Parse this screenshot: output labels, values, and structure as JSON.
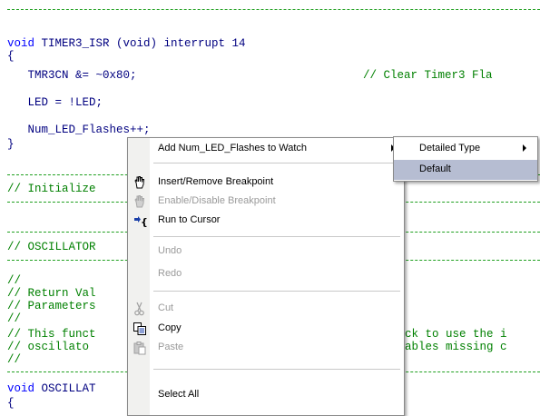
{
  "editor": {
    "lines": {
      "sep1": "//---------------------------------------------------------------------------------",
      "func_sig_kw": "void",
      "func_sig_rest": " TIMER3_ISR (void) interrupt 14",
      "open_brace": "{",
      "tmr_stmt": "   TMR3CN &= ~0x80;",
      "tmr_comment": "// Clear Timer3 Fla",
      "led_stmt": "   LED = !LED;",
      "num_stmt": "   Num_LED_Flashes++;",
      "close_brace": "}",
      "sep2": "//---------------------------------------------------------------------------------",
      "init_comment": "// Initialize",
      "sep3": "//---------------------------------------------------------------------------------",
      "sep4": "//---------------------------------------------------------------------------------",
      "osc_comment": "// OSCILLATOR",
      "sep5": "//---------------------------------------------------------------------------------",
      "blank_comment1": "//",
      "return_comment": "// Return Val",
      "params_comment": "// Parameters",
      "blank_comment2": "//",
      "this_func_comment": "// This funct",
      "this_func_tail": "ck to use the i",
      "osc_comment2": "// oscillato",
      "osc_comment2_tail": "ables missing c",
      "blank_comment3": "//",
      "sep6": "//---------------------------------------------------------------------------------",
      "void_osc_kw": "void",
      "void_osc_rest": " OSCILLAT",
      "open_brace2": "{"
    }
  },
  "context_menu": {
    "items": [
      {
        "label": "Add Num_LED_Flashes to Watch",
        "has_submenu": true,
        "enabled": true
      },
      {
        "label": "Insert/Remove Breakpoint",
        "enabled": true,
        "icon": "hand-breakpoint-icon"
      },
      {
        "label": "Enable/Disable Breakpoint",
        "enabled": false,
        "icon": "toggle-breakpoint-icon"
      },
      {
        "label": "Run to Cursor",
        "enabled": true,
        "icon": "run-to-cursor-icon"
      },
      {
        "label": "Undo",
        "enabled": false
      },
      {
        "label": "Redo",
        "enabled": false
      },
      {
        "label": "Cut",
        "enabled": false,
        "icon": "scissors-icon"
      },
      {
        "label": "Copy",
        "enabled": true,
        "icon": "copy-icon"
      },
      {
        "label": "Paste",
        "enabled": false,
        "icon": "paste-icon"
      },
      {
        "label": "Select All",
        "enabled": true
      }
    ]
  },
  "submenu": {
    "items": [
      {
        "label": "Detailed Type",
        "has_submenu": true
      },
      {
        "label": "Default",
        "highlighted": true
      }
    ]
  },
  "colors": {
    "code_text": "#000080",
    "comment": "#008000",
    "keyword": "#0000ff",
    "menu_highlight": "#b6bdd2"
  }
}
